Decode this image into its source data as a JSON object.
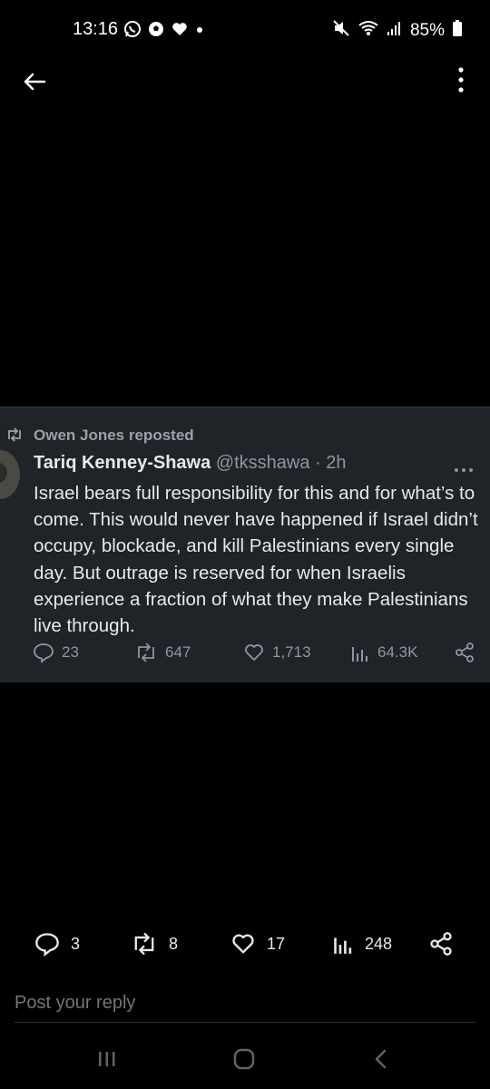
{
  "status_bar": {
    "time": "13:16",
    "battery": "85%",
    "left_icons": [
      "whatsapp-icon",
      "soccer-ball-icon",
      "heart-icon",
      "dot-icon"
    ],
    "right_icons": [
      "mute-icon",
      "wifi-icon",
      "signal-icon",
      "battery-icon"
    ]
  },
  "top_bar": {
    "back_icon": "arrow-left-icon",
    "menu_icon": "more-vertical-icon"
  },
  "quoted_post": {
    "repost_label": "Owen Jones reposted",
    "author_name": "Tariq Kenney-Shawa",
    "author_handle": "@tksshawa",
    "separator": "·",
    "time": "2h",
    "text": "Israel bears full responsibility for this and for what’s to come. This would never have happened if Israel didn’t occupy, blockade, and kill Palestinians every single day. But outrage is reserved for when Israelis experience a fraction of what they make Palestinians live through.",
    "replies": "23",
    "reposts": "647",
    "likes": "1,713",
    "views": "64.3K"
  },
  "post_actions": {
    "replies": "3",
    "reposts": "8",
    "likes": "17",
    "views": "248"
  },
  "reply_box": {
    "placeholder": "Post your reply"
  },
  "nav_bar": {
    "items": [
      "recents-icon",
      "home-icon",
      "back-icon"
    ]
  },
  "colors": {
    "background": "#000000",
    "card": "#202327",
    "muted": "#8b98a5",
    "text": "#e7e9ea"
  }
}
